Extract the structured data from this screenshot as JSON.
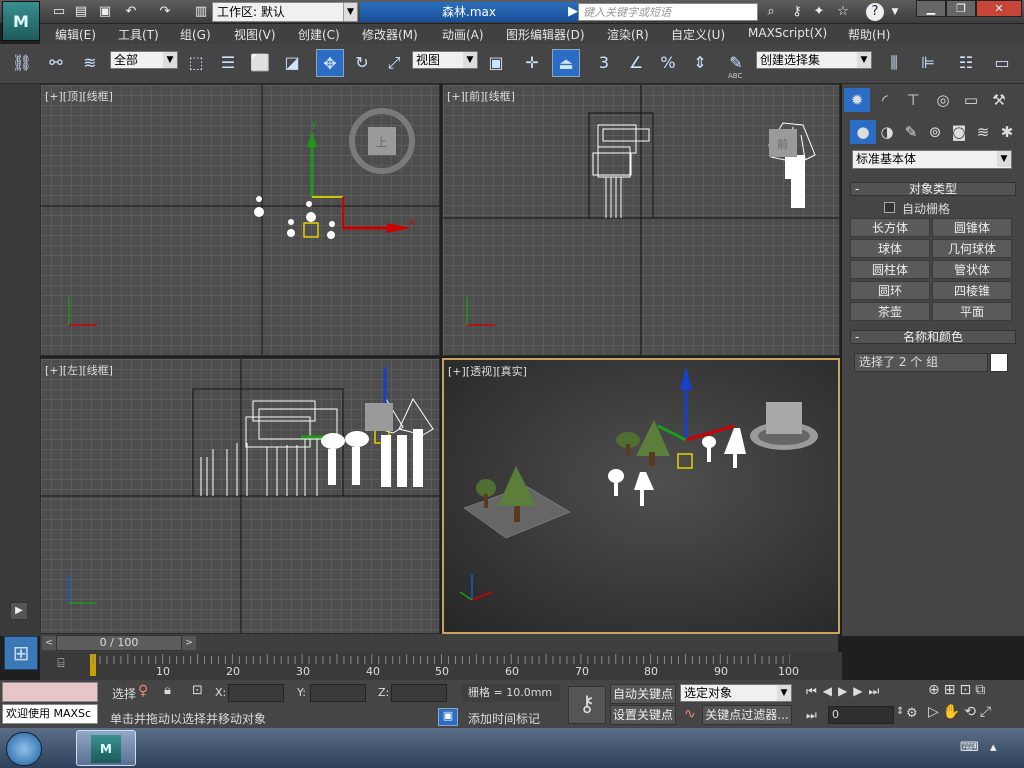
{
  "titlebar": {
    "workspace": "工作区: 默认",
    "document_title": "森林.max",
    "search_placeholder": "键入关键字或短语"
  },
  "menu": [
    "编辑(E)",
    "工具(T)",
    "组(G)",
    "视图(V)",
    "创建(C)",
    "修改器(M)",
    "动画(A)",
    "图形编辑器(D)",
    "渲染(R)",
    "自定义(U)",
    "MAXScript(X)",
    "帮助(H)"
  ],
  "toolbar": {
    "selection_filter": "全部",
    "ref_coord": "视图",
    "named_selection": "创建选择集",
    "snap_label": "3",
    "abc_label": "ABC"
  },
  "viewports": {
    "top": "[+][顶][线框]",
    "front": "[+][前][线框]",
    "left": "[+][左][线框]",
    "persp": "[+][透视][真实]",
    "viewcube_top": "上",
    "viewcube_front": "前"
  },
  "command_panel": {
    "category": "标准基本体",
    "object_type_header": "对象类型",
    "autogrid": "自动栅格",
    "buttons": [
      "长方体",
      "圆锥体",
      "球体",
      "几何球体",
      "圆柱体",
      "管状体",
      "圆环",
      "四棱锥",
      "茶壶",
      "平面"
    ],
    "name_color_header": "名称和颜色",
    "name_value": "选择了 2 个 组"
  },
  "timeline": {
    "frame_counter": "0 / 100",
    "ticks": [
      "10",
      "20",
      "30",
      "40",
      "50",
      "60",
      "70",
      "80",
      "90",
      "100"
    ]
  },
  "status": {
    "welcome": "欢迎使用 MAXSc",
    "select_label": "选择",
    "x_label": "X:",
    "y_label": "Y:",
    "z_label": "Z:",
    "grid": "栅格 = 10.0mm",
    "prompt": "单击并拖动以选择并移动对象",
    "add_time_tag": "添加时间标记",
    "auto_key": "自动关键点",
    "set_key": "设置关键点",
    "key_mode": "选定对象",
    "key_filters": "关键点过滤器...",
    "current_frame": "0"
  }
}
